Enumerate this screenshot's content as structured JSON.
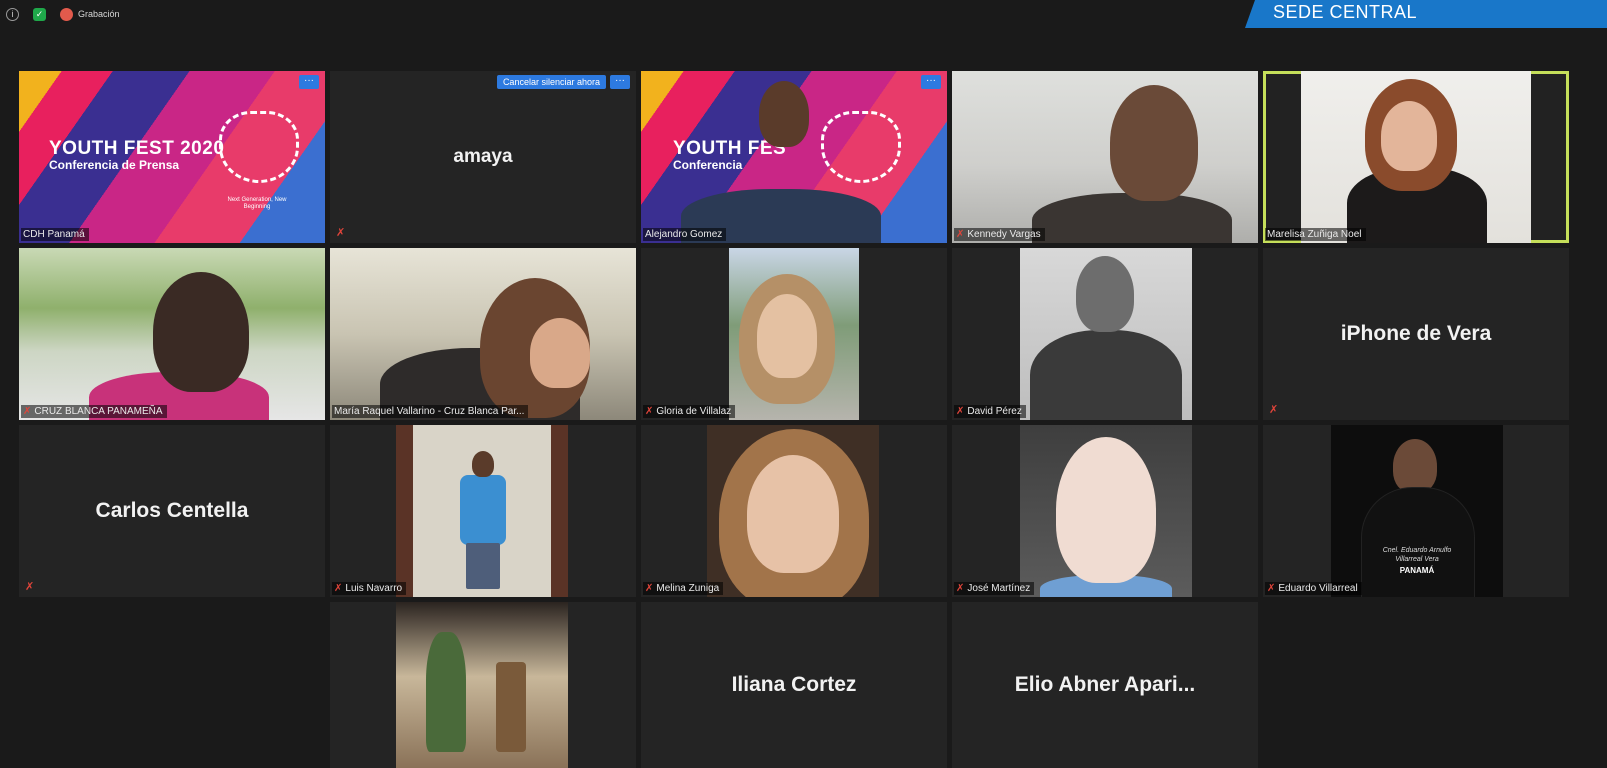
{
  "topbar": {
    "recording_label": "Grabación",
    "banner": "SEDE CENTRAL"
  },
  "tiles": {
    "cdh": {
      "name": "CDH Panamá",
      "headline": "YOUTH FEST 2020",
      "subline": "Conferencia de Prensa",
      "tagline": "Next Generation, New Beginning"
    },
    "amaya": {
      "name": "amaya",
      "unmute_label": "Cancelar silenciar ahora"
    },
    "alejandro": {
      "name": "Alejandro Gomez",
      "headline": "YOUTH FES",
      "subline": "Conferencia"
    },
    "kennedy": {
      "name": "Kennedy Vargas"
    },
    "marelisa": {
      "name": "Marelisa Zuñiga Noel"
    },
    "cruzblanca": {
      "name": "CRUZ BLANCA PANAMEÑA"
    },
    "maria": {
      "name": "María Raquel Vallarino - Cruz Blanca Par..."
    },
    "gloria": {
      "name": "Gloria de Villalaz"
    },
    "david": {
      "name": "David Pérez"
    },
    "iphone": {
      "name": "iPhone de Vera"
    },
    "carlos": {
      "name": "Carlos Centella"
    },
    "luis": {
      "name": "Luis Navarro"
    },
    "melina": {
      "name": "Melina Zuniga"
    },
    "jose": {
      "name": "José Martínez"
    },
    "eduardo": {
      "name": "Eduardo Villarreal",
      "shirt_line1": "Cnel. Eduardo Arnulfo",
      "shirt_line2": "Villarreal Vera",
      "shirt_line3": "PANAMÁ"
    },
    "iliana": {
      "name": "Iliana Cortez"
    },
    "elio": {
      "name": "Elio Abner Apari..."
    }
  },
  "icons": {
    "more": "more-options-icon",
    "mic": "mic-muted-icon"
  },
  "colors": {
    "active_border": "#c5df5a",
    "accent": "#2d7ae0",
    "muted": "#e0443a",
    "banner": "#1977c9"
  }
}
